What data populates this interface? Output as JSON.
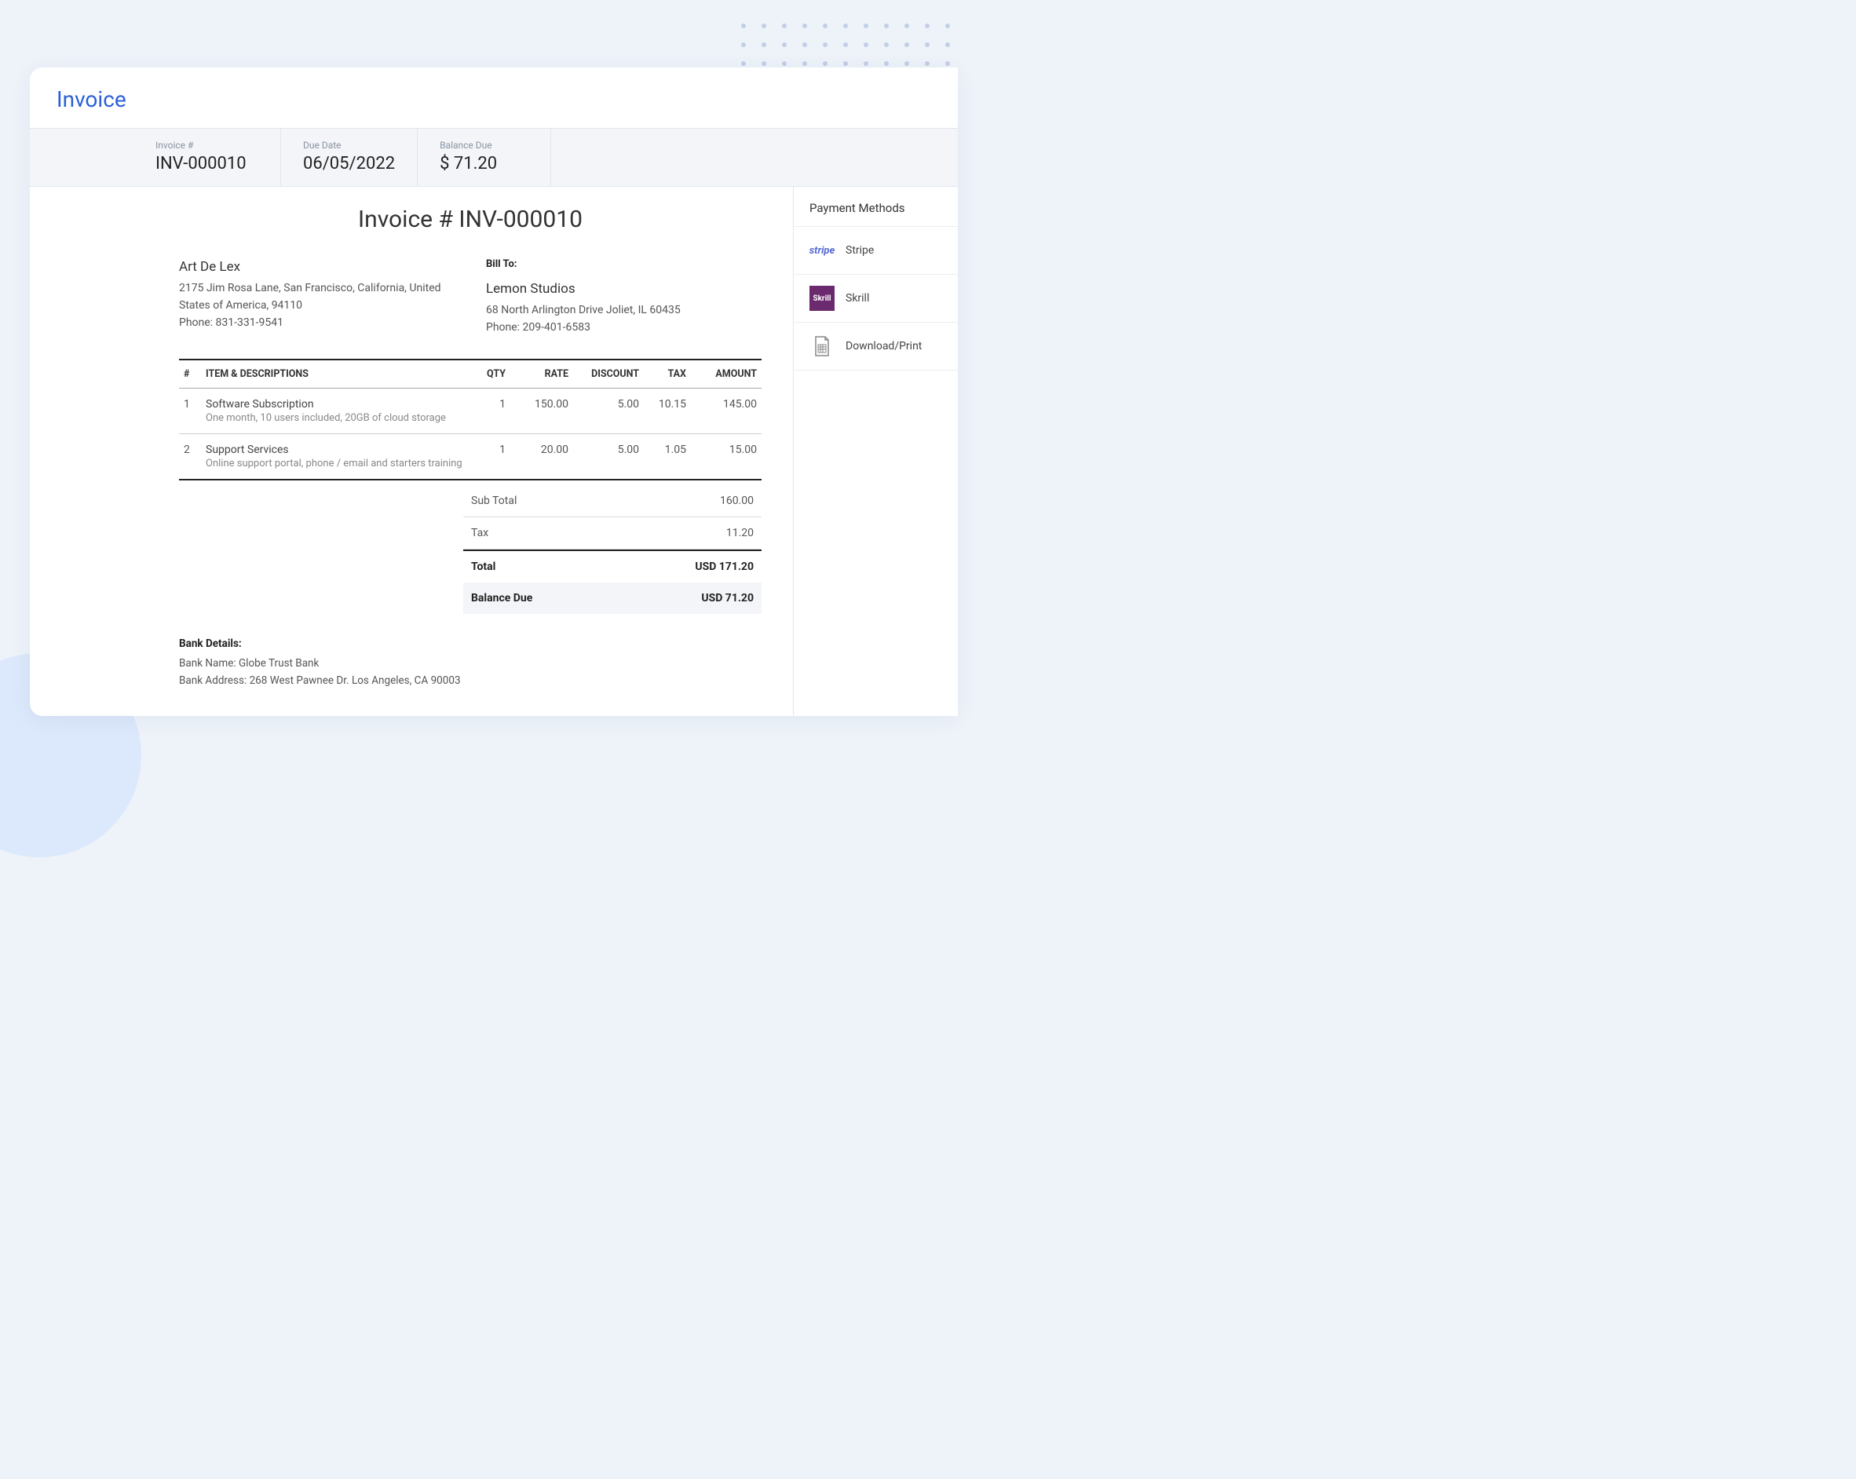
{
  "page_title": "Invoice",
  "meta": {
    "invoice_label": "Invoice #",
    "invoice_number": "INV-000010",
    "due_date_label": "Due Date",
    "due_date": "06/05/2022",
    "balance_due_label": "Balance Due",
    "balance_due": "$ 71.20"
  },
  "doc_title": "Invoice # INV-000010",
  "from": {
    "name": "Art De Lex",
    "address": "2175 Jim Rosa Lane, San Francisco, California, United States of America, 94110",
    "phone": "Phone: 831-331-9541"
  },
  "to": {
    "heading": "Bill To:",
    "name": "Lemon Studios",
    "address": "68 North Arlington Drive Joliet, IL 60435",
    "phone": "Phone: 209-401-6583"
  },
  "columns": {
    "num": "#",
    "item": "ITEM & DESCRIPTIONS",
    "qty": "QTY",
    "rate": "RATE",
    "discount": "DISCOUNT",
    "tax": "TAX",
    "amount": "AMOUNT"
  },
  "items": [
    {
      "num": "1",
      "name": "Software Subscription",
      "desc": "One month, 10 users included, 20GB of cloud storage",
      "qty": "1",
      "rate": "150.00",
      "discount": "5.00",
      "tax": "10.15",
      "amount": "145.00"
    },
    {
      "num": "2",
      "name": "Support Services",
      "desc": "Online support portal, phone / email and starters training",
      "qty": "1",
      "rate": "20.00",
      "discount": "5.00",
      "tax": "1.05",
      "amount": "15.00"
    }
  ],
  "totals": {
    "subtotal_label": "Sub Total",
    "subtotal": "160.00",
    "tax_label": "Tax",
    "tax": "11.20",
    "total_label": "Total",
    "total": "USD 171.20",
    "balance_label": "Balance Due",
    "balance": "USD 71.20"
  },
  "bank": {
    "heading": "Bank Details:",
    "name": "Bank Name:   Globe Trust Bank",
    "address": "Bank Address:  268 West Pawnee Dr. Los Angeles, CA 90003"
  },
  "sidebar": {
    "title": "Payment Methods",
    "methods": [
      {
        "label": "Stripe"
      },
      {
        "label": "Skrill"
      },
      {
        "label": "Download/Print"
      }
    ]
  }
}
